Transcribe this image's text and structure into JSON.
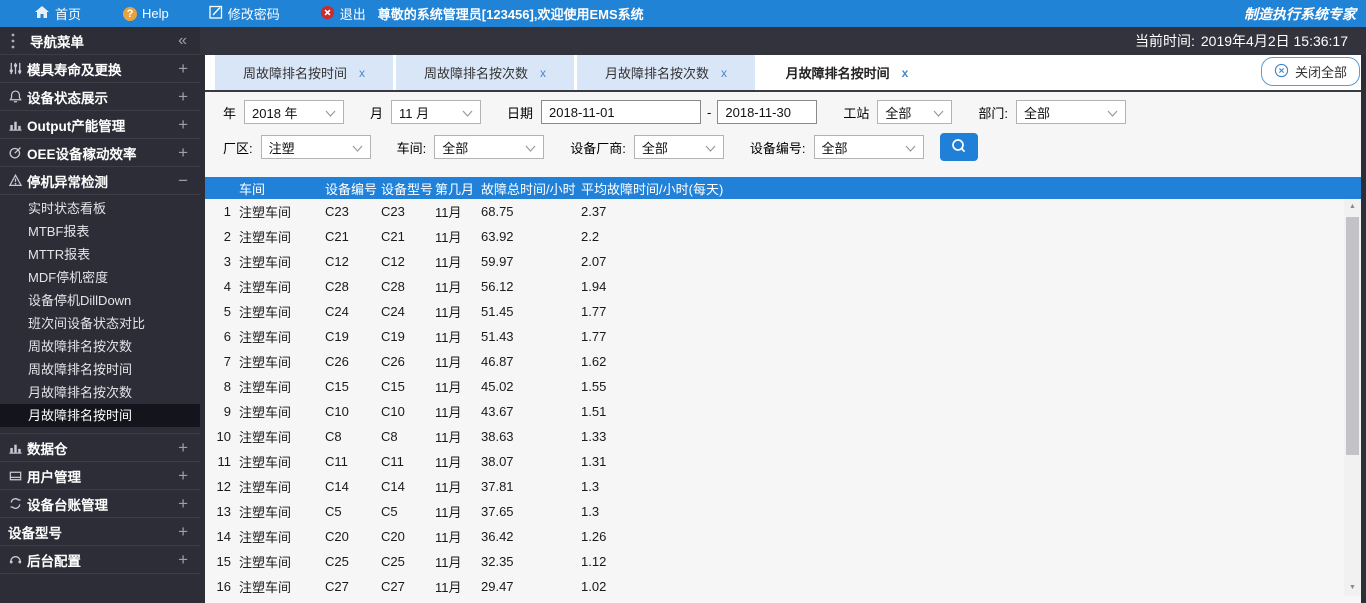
{
  "topbar": {
    "home": "首页",
    "help": "Help",
    "change_password": "修改密码",
    "logout": "退出",
    "welcome": "尊敬的系统管理员[123456],欢迎使用EMS系统",
    "brand": "制造执行系统专家"
  },
  "timebar": {
    "label": "当前时间:",
    "value": "2019年4月2日 15:36:17"
  },
  "sidebar": {
    "title": "导航菜单",
    "collapse": "«",
    "groups": [
      {
        "label": "模具寿命及更换",
        "icon": "sliders-icon",
        "toggle": "+"
      },
      {
        "label": "设备状态展示",
        "icon": "device-status-icon",
        "toggle": "+"
      },
      {
        "label": "Output产能管理",
        "icon": "output-chart-icon",
        "toggle": "+"
      },
      {
        "label": "OEE设备稼动效率",
        "icon": "oee-gauge-icon",
        "toggle": "+"
      },
      {
        "label": "停机异常检测",
        "icon": "warning-icon",
        "toggle": "−",
        "expanded": true,
        "children": [
          "实时状态看板",
          "MTBF报表",
          "MTTR报表",
          "MDF停机密度",
          "设备停机DillDown",
          "班次间设备状态对比",
          "周故障排名按次数",
          "周故障排名按时间",
          "月故障排名按次数",
          "月故障排名按时间"
        ],
        "active_child": 9
      },
      {
        "label": "数据仓",
        "icon": "datastore-icon",
        "toggle": "+"
      },
      {
        "label": "用户管理",
        "icon": "user-management-icon",
        "toggle": "+"
      },
      {
        "label": "设备台账管理",
        "icon": "equipment-ledger-icon",
        "toggle": "+"
      },
      {
        "label": "设备型号",
        "icon": null,
        "toggle": "+"
      },
      {
        "label": "后台配置",
        "icon": "backend-config-icon",
        "toggle": "+"
      }
    ]
  },
  "tabs": {
    "close_all": "关闭全部",
    "items": [
      {
        "label": "周故障排名按时间",
        "active": false
      },
      {
        "label": "周故障排名按次数",
        "active": false
      },
      {
        "label": "月故障排名按次数",
        "active": false
      },
      {
        "label": "月故障排名按时间",
        "active": true
      }
    ]
  },
  "filters": {
    "year_label": "年",
    "year_value": "2018 年",
    "month_label": "月",
    "month_value": "11 月",
    "date_label": "日期",
    "date_from": "2018-11-01",
    "date_sep": "-",
    "date_to": "2018-11-30",
    "station_label": "工站",
    "station_value": "全部",
    "dept_label": "部门:",
    "dept_value": "全部",
    "plant_label": "厂区:",
    "plant_value": "注塑",
    "workshop_label": "车间:",
    "workshop_value": "全部",
    "vendor_label": "设备厂商:",
    "vendor_value": "全部",
    "device_label": "设备编号:",
    "device_value": "全部"
  },
  "table": {
    "columns": [
      "",
      "车间",
      "设备编号",
      "设备型号",
      "第几月",
      "故障总时间/小时",
      "平均故障时间/小时(每天)"
    ],
    "rows": [
      [
        "1",
        "注塑车间",
        "C23",
        "C23",
        "11月",
        "68.75",
        "2.37"
      ],
      [
        "2",
        "注塑车间",
        "C21",
        "C21",
        "11月",
        "63.92",
        "2.2"
      ],
      [
        "3",
        "注塑车间",
        "C12",
        "C12",
        "11月",
        "59.97",
        "2.07"
      ],
      [
        "4",
        "注塑车间",
        "C28",
        "C28",
        "11月",
        "56.12",
        "1.94"
      ],
      [
        "5",
        "注塑车间",
        "C24",
        "C24",
        "11月",
        "51.45",
        "1.77"
      ],
      [
        "6",
        "注塑车间",
        "C19",
        "C19",
        "11月",
        "51.43",
        "1.77"
      ],
      [
        "7",
        "注塑车间",
        "C26",
        "C26",
        "11月",
        "46.87",
        "1.62"
      ],
      [
        "8",
        "注塑车间",
        "C15",
        "C15",
        "11月",
        "45.02",
        "1.55"
      ],
      [
        "9",
        "注塑车间",
        "C10",
        "C10",
        "11月",
        "43.67",
        "1.51"
      ],
      [
        "10",
        "注塑车间",
        "C8",
        "C8",
        "11月",
        "38.63",
        "1.33"
      ],
      [
        "11",
        "注塑车间",
        "C11",
        "C11",
        "11月",
        "38.07",
        "1.31"
      ],
      [
        "12",
        "注塑车间",
        "C14",
        "C14",
        "11月",
        "37.81",
        "1.3"
      ],
      [
        "13",
        "注塑车间",
        "C5",
        "C5",
        "11月",
        "37.65",
        "1.3"
      ],
      [
        "14",
        "注塑车间",
        "C20",
        "C20",
        "11月",
        "36.42",
        "1.26"
      ],
      [
        "15",
        "注塑车间",
        "C25",
        "C25",
        "11月",
        "32.35",
        "1.12"
      ],
      [
        "16",
        "注塑车间",
        "C27",
        "C27",
        "11月",
        "29.47",
        "1.02"
      ]
    ]
  },
  "colors": {
    "topbar_blue": "#2083d6",
    "table_header_blue": "#2181d8",
    "dark_bg": "#2d2d37",
    "tab_inactive": "#d8e6f7",
    "search_button": "#2080d8"
  }
}
